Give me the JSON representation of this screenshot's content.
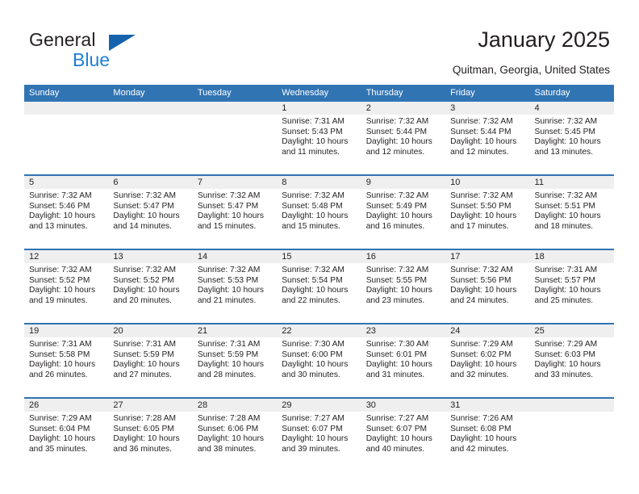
{
  "brand": {
    "word_one": "General",
    "word_two": "Blue",
    "triangle_icon": "triangle-icon",
    "accent_dark": "#1563ad",
    "accent_light": "#1f7fd4"
  },
  "header": {
    "title": "January 2025",
    "location": "Quitman, Georgia, United States"
  },
  "colors": {
    "header_blue": "#3174b4",
    "daynum_gray": "#efefef",
    "text": "#231f20"
  },
  "weekdays": [
    "Sunday",
    "Monday",
    "Tuesday",
    "Wednesday",
    "Thursday",
    "Friday",
    "Saturday"
  ],
  "labels": {
    "sunrise_prefix": "Sunrise:",
    "sunset_prefix": "Sunset:",
    "daylight_prefix": "Daylight:"
  },
  "weeks": [
    {
      "days": [
        {
          "num": "",
          "l1": "",
          "l2": "",
          "l3": "",
          "l4": ""
        },
        {
          "num": "",
          "l1": "",
          "l2": "",
          "l3": "",
          "l4": ""
        },
        {
          "num": "",
          "l1": "",
          "l2": "",
          "l3": "",
          "l4": ""
        },
        {
          "num": "1",
          "l1": "Sunrise: 7:31 AM",
          "l2": "Sunset: 5:43 PM",
          "l3": "Daylight: 10 hours",
          "l4": "and 11 minutes."
        },
        {
          "num": "2",
          "l1": "Sunrise: 7:32 AM",
          "l2": "Sunset: 5:44 PM",
          "l3": "Daylight: 10 hours",
          "l4": "and 12 minutes."
        },
        {
          "num": "3",
          "l1": "Sunrise: 7:32 AM",
          "l2": "Sunset: 5:44 PM",
          "l3": "Daylight: 10 hours",
          "l4": "and 12 minutes."
        },
        {
          "num": "4",
          "l1": "Sunrise: 7:32 AM",
          "l2": "Sunset: 5:45 PM",
          "l3": "Daylight: 10 hours",
          "l4": "and 13 minutes."
        }
      ]
    },
    {
      "days": [
        {
          "num": "5",
          "l1": "Sunrise: 7:32 AM",
          "l2": "Sunset: 5:46 PM",
          "l3": "Daylight: 10 hours",
          "l4": "and 13 minutes."
        },
        {
          "num": "6",
          "l1": "Sunrise: 7:32 AM",
          "l2": "Sunset: 5:47 PM",
          "l3": "Daylight: 10 hours",
          "l4": "and 14 minutes."
        },
        {
          "num": "7",
          "l1": "Sunrise: 7:32 AM",
          "l2": "Sunset: 5:47 PM",
          "l3": "Daylight: 10 hours",
          "l4": "and 15 minutes."
        },
        {
          "num": "8",
          "l1": "Sunrise: 7:32 AM",
          "l2": "Sunset: 5:48 PM",
          "l3": "Daylight: 10 hours",
          "l4": "and 15 minutes."
        },
        {
          "num": "9",
          "l1": "Sunrise: 7:32 AM",
          "l2": "Sunset: 5:49 PM",
          "l3": "Daylight: 10 hours",
          "l4": "and 16 minutes."
        },
        {
          "num": "10",
          "l1": "Sunrise: 7:32 AM",
          "l2": "Sunset: 5:50 PM",
          "l3": "Daylight: 10 hours",
          "l4": "and 17 minutes."
        },
        {
          "num": "11",
          "l1": "Sunrise: 7:32 AM",
          "l2": "Sunset: 5:51 PM",
          "l3": "Daylight: 10 hours",
          "l4": "and 18 minutes."
        }
      ]
    },
    {
      "days": [
        {
          "num": "12",
          "l1": "Sunrise: 7:32 AM",
          "l2": "Sunset: 5:52 PM",
          "l3": "Daylight: 10 hours",
          "l4": "and 19 minutes."
        },
        {
          "num": "13",
          "l1": "Sunrise: 7:32 AM",
          "l2": "Sunset: 5:52 PM",
          "l3": "Daylight: 10 hours",
          "l4": "and 20 minutes."
        },
        {
          "num": "14",
          "l1": "Sunrise: 7:32 AM",
          "l2": "Sunset: 5:53 PM",
          "l3": "Daylight: 10 hours",
          "l4": "and 21 minutes."
        },
        {
          "num": "15",
          "l1": "Sunrise: 7:32 AM",
          "l2": "Sunset: 5:54 PM",
          "l3": "Daylight: 10 hours",
          "l4": "and 22 minutes."
        },
        {
          "num": "16",
          "l1": "Sunrise: 7:32 AM",
          "l2": "Sunset: 5:55 PM",
          "l3": "Daylight: 10 hours",
          "l4": "and 23 minutes."
        },
        {
          "num": "17",
          "l1": "Sunrise: 7:32 AM",
          "l2": "Sunset: 5:56 PM",
          "l3": "Daylight: 10 hours",
          "l4": "and 24 minutes."
        },
        {
          "num": "18",
          "l1": "Sunrise: 7:31 AM",
          "l2": "Sunset: 5:57 PM",
          "l3": "Daylight: 10 hours",
          "l4": "and 25 minutes."
        }
      ]
    },
    {
      "days": [
        {
          "num": "19",
          "l1": "Sunrise: 7:31 AM",
          "l2": "Sunset: 5:58 PM",
          "l3": "Daylight: 10 hours",
          "l4": "and 26 minutes."
        },
        {
          "num": "20",
          "l1": "Sunrise: 7:31 AM",
          "l2": "Sunset: 5:59 PM",
          "l3": "Daylight: 10 hours",
          "l4": "and 27 minutes."
        },
        {
          "num": "21",
          "l1": "Sunrise: 7:31 AM",
          "l2": "Sunset: 5:59 PM",
          "l3": "Daylight: 10 hours",
          "l4": "and 28 minutes."
        },
        {
          "num": "22",
          "l1": "Sunrise: 7:30 AM",
          "l2": "Sunset: 6:00 PM",
          "l3": "Daylight: 10 hours",
          "l4": "and 30 minutes."
        },
        {
          "num": "23",
          "l1": "Sunrise: 7:30 AM",
          "l2": "Sunset: 6:01 PM",
          "l3": "Daylight: 10 hours",
          "l4": "and 31 minutes."
        },
        {
          "num": "24",
          "l1": "Sunrise: 7:29 AM",
          "l2": "Sunset: 6:02 PM",
          "l3": "Daylight: 10 hours",
          "l4": "and 32 minutes."
        },
        {
          "num": "25",
          "l1": "Sunrise: 7:29 AM",
          "l2": "Sunset: 6:03 PM",
          "l3": "Daylight: 10 hours",
          "l4": "and 33 minutes."
        }
      ]
    },
    {
      "days": [
        {
          "num": "26",
          "l1": "Sunrise: 7:29 AM",
          "l2": "Sunset: 6:04 PM",
          "l3": "Daylight: 10 hours",
          "l4": "and 35 minutes."
        },
        {
          "num": "27",
          "l1": "Sunrise: 7:28 AM",
          "l2": "Sunset: 6:05 PM",
          "l3": "Daylight: 10 hours",
          "l4": "and 36 minutes."
        },
        {
          "num": "28",
          "l1": "Sunrise: 7:28 AM",
          "l2": "Sunset: 6:06 PM",
          "l3": "Daylight: 10 hours",
          "l4": "and 38 minutes."
        },
        {
          "num": "29",
          "l1": "Sunrise: 7:27 AM",
          "l2": "Sunset: 6:07 PM",
          "l3": "Daylight: 10 hours",
          "l4": "and 39 minutes."
        },
        {
          "num": "30",
          "l1": "Sunrise: 7:27 AM",
          "l2": "Sunset: 6:07 PM",
          "l3": "Daylight: 10 hours",
          "l4": "and 40 minutes."
        },
        {
          "num": "31",
          "l1": "Sunrise: 7:26 AM",
          "l2": "Sunset: 6:08 PM",
          "l3": "Daylight: 10 hours",
          "l4": "and 42 minutes."
        },
        {
          "num": "",
          "l1": "",
          "l2": "",
          "l3": "",
          "l4": ""
        }
      ]
    }
  ]
}
